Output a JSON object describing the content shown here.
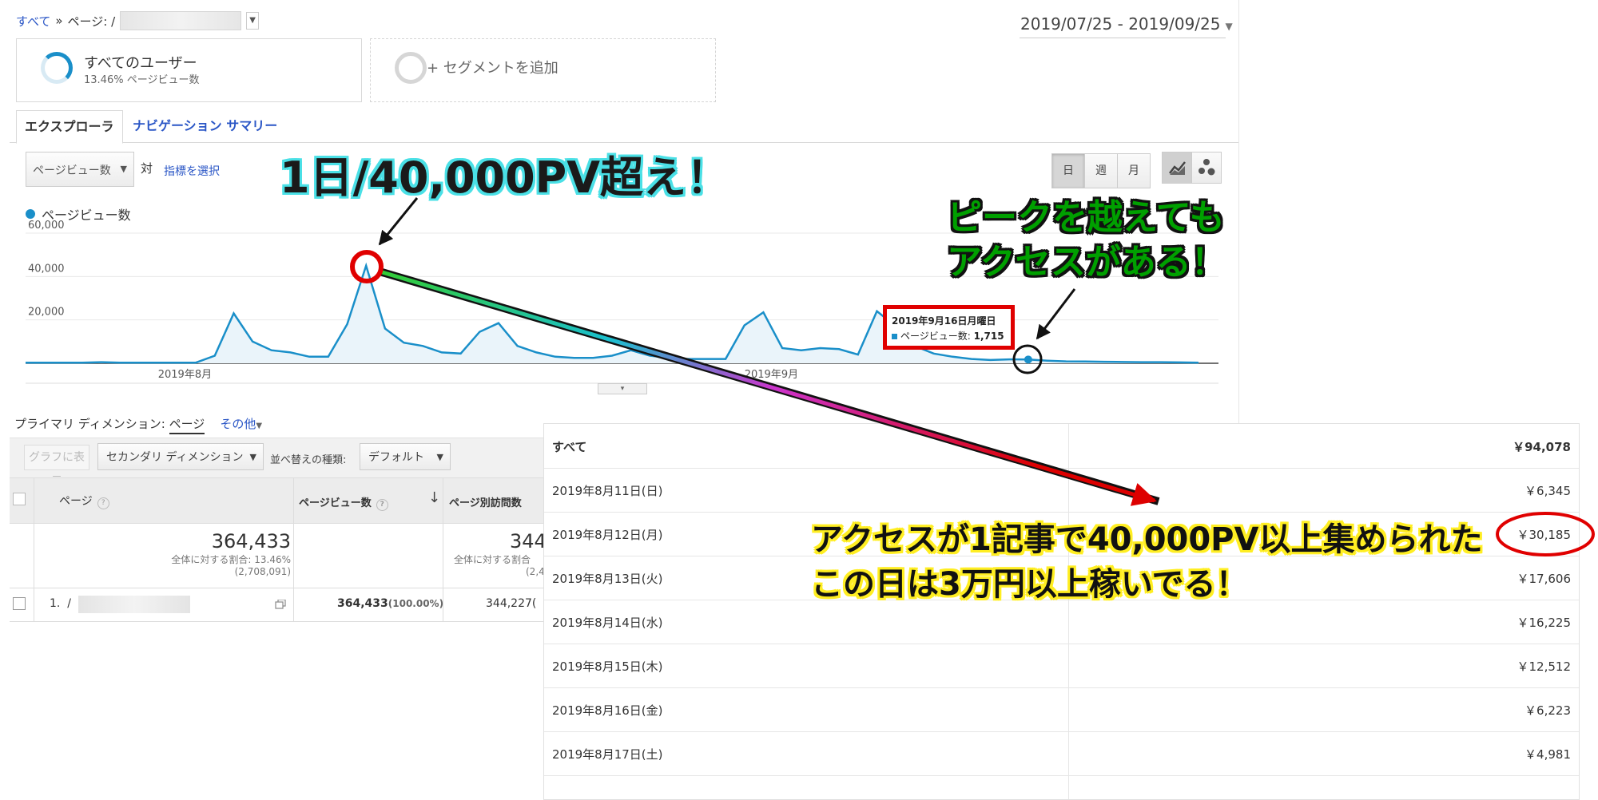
{
  "breadcrumb": {
    "all": "すべて",
    "sep": "»",
    "page_label": "ページ: /"
  },
  "date_range": "2019/07/25 - 2019/09/25",
  "segments": {
    "active": {
      "title": "すべてのユーザー",
      "subtitle": "13.46% ページビュー数"
    },
    "add_label": "+ セグメントを追加"
  },
  "tabs": {
    "explorer": "エクスプローラ",
    "navigation": "ナビゲーション サマリー"
  },
  "chart_controls": {
    "metric": "ページビュー数",
    "vs": "対",
    "pick_metric": "指標を選択",
    "periods": [
      "日",
      "週",
      "月"
    ],
    "active_period": "日"
  },
  "legend": "ページビュー数",
  "chart_data": {
    "type": "area",
    "series": [
      {
        "name": "ページビュー数",
        "color": "#1a8fc9"
      }
    ],
    "y_ticks": [
      "60,000",
      "40,000",
      "20,000"
    ],
    "x_labels": [
      "2019年8月",
      "2019年9月"
    ],
    "ylim": [
      0,
      60000
    ],
    "x": [
      "2019-07-25",
      "2019-07-26",
      "2019-07-27",
      "2019-07-28",
      "2019-07-29",
      "2019-07-30",
      "2019-07-31",
      "2019-08-01",
      "2019-08-02",
      "2019-08-03",
      "2019-08-04",
      "2019-08-05",
      "2019-08-06",
      "2019-08-07",
      "2019-08-08",
      "2019-08-09",
      "2019-08-10",
      "2019-08-11",
      "2019-08-12",
      "2019-08-13",
      "2019-08-14",
      "2019-08-15",
      "2019-08-16",
      "2019-08-17",
      "2019-08-18",
      "2019-08-19",
      "2019-08-20",
      "2019-08-21",
      "2019-08-22",
      "2019-08-23",
      "2019-08-24",
      "2019-08-25",
      "2019-08-26",
      "2019-08-27",
      "2019-08-28",
      "2019-08-29",
      "2019-08-30",
      "2019-08-31",
      "2019-09-01",
      "2019-09-02",
      "2019-09-03",
      "2019-09-04",
      "2019-09-05",
      "2019-09-06",
      "2019-09-07",
      "2019-09-08",
      "2019-09-09",
      "2019-09-10",
      "2019-09-11",
      "2019-09-12",
      "2019-09-13",
      "2019-09-14",
      "2019-09-15",
      "2019-09-16",
      "2019-09-17",
      "2019-09-18",
      "2019-09-19",
      "2019-09-20",
      "2019-09-21",
      "2019-09-22",
      "2019-09-23",
      "2019-09-24",
      "2019-09-25"
    ],
    "values": [
      300,
      300,
      300,
      300,
      500,
      300,
      300,
      300,
      300,
      300,
      3500,
      23000,
      10000,
      6000,
      5000,
      3000,
      3000,
      18000,
      45000,
      16000,
      9500,
      8000,
      5000,
      4500,
      14500,
      18500,
      8000,
      5000,
      3000,
      2500,
      2500,
      3500,
      6000,
      3500,
      2500,
      2000,
      2000,
      2000,
      17500,
      23500,
      7000,
      6000,
      7000,
      6500,
      4000,
      24000,
      17000,
      8000,
      4500,
      3000,
      2000,
      1500,
      1800,
      1715,
      1200,
      900,
      800,
      700,
      600,
      500,
      500,
      400,
      300
    ]
  },
  "chart_toggle": "▾",
  "table": {
    "primary_dim_label": "プライマリ ディメンション:",
    "primary_dim_value": "ページ",
    "other": "その他",
    "graph_btn": "グラフに表示",
    "secondary_dim": "セカンダリ ディメンション",
    "sort_label": "並べ替えの種類:",
    "sort_value": "デフォルト",
    "col_page": "ページ",
    "col_pv": "ページビュー数",
    "col_upv": "ページ別訪問数",
    "totals": {
      "pv": "364,433",
      "pv_pct": "全体に対する割合: 13.46%",
      "pv_base": "(2,708,091)",
      "upv": "344",
      "upv_pct": "全体に対する割合",
      "upv_base": "(2,4"
    },
    "rows": [
      {
        "idx": "1.",
        "path": "/",
        "pv": "364,433",
        "pv_pct": "(100.00%)",
        "upv": "344,227("
      }
    ]
  },
  "revenue": {
    "rows": [
      {
        "date": "すべて",
        "amount": "￥94,078"
      },
      {
        "date": "2019年8月11日(日)",
        "amount": "￥6,345"
      },
      {
        "date": "2019年8月12日(月)",
        "amount": "￥30,185"
      },
      {
        "date": "2019年8月13日(火)",
        "amount": "￥17,606"
      },
      {
        "date": "2019年8月14日(水)",
        "amount": "￥16,225"
      },
      {
        "date": "2019年8月15日(木)",
        "amount": "￥12,512"
      },
      {
        "date": "2019年8月16日(金)",
        "amount": "￥6,223"
      },
      {
        "date": "2019年8月17日(土)",
        "amount": "￥4,981"
      }
    ]
  },
  "annotations": {
    "peak": "1日/40,000PV超え！",
    "after_peak_1": "ピークを越えても",
    "after_peak_2": "アクセスがある！",
    "revenue_1": "アクセスが1記事で40,000PV以上集められた",
    "revenue_2": "この日は3万円以上稼いでる！",
    "tooltip_date": "2019年9月16日月曜日",
    "tooltip_label": "ページビュー数:",
    "tooltip_value": "1,715"
  },
  "colors": {
    "accent": "#1a8fc9",
    "highlight_red": "#e00000"
  }
}
